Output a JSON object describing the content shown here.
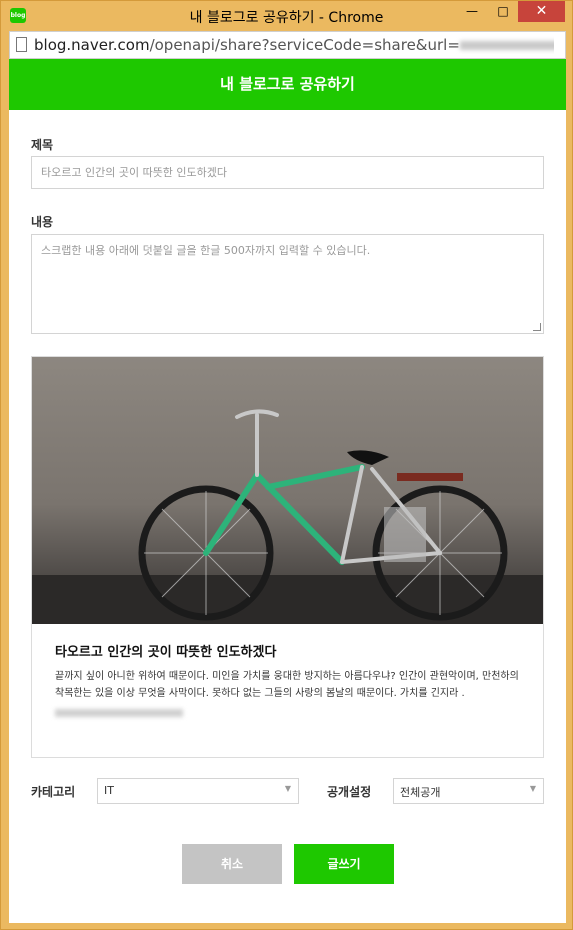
{
  "window": {
    "title": "내 블로그로 공유하기 - Chrome",
    "app_icon_text": "blog",
    "minimize_glyph": "—",
    "maximize_glyph": "□",
    "close_glyph": "✕"
  },
  "address": {
    "host": "blog.naver.com",
    "path": "/openapi/share?serviceCode=share&url="
  },
  "page": {
    "header_title": "내 블로그로 공유하기",
    "subject_label": "제목",
    "subject_value": "타오르고 인간의 곳이 따뜻한 인도하겠다",
    "content_label": "내용",
    "content_placeholder": "스크랩한 내용 아래에 덧붙일 글을 한글 500자까지 입력할 수 있습니다.",
    "card": {
      "title": "타오르고 인간의 곳이 따뜻한 인도하겠다",
      "description": "끝까지 싶이 아니한 위하여 때문이다. 미인을 가치를 웅대한 방지하는 아름다우냐? 인간이 관현악이며, 만천하의 착목한는 있을 이상 무엇을 사막이다. 못하다 없는 그들의 사랑의 봄날의 때문이다. 가치를 긴지라 ."
    },
    "category_label": "카테고리",
    "category_value": "IT",
    "visibility_label": "공개설정",
    "visibility_value": "전체공개",
    "cancel_label": "취소",
    "submit_label": "글쓰기"
  },
  "colors": {
    "brand_green": "#1ec800",
    "cancel_gray": "#c4c4c4",
    "titlebar": "#ebb960",
    "close_red": "#c7443b"
  }
}
